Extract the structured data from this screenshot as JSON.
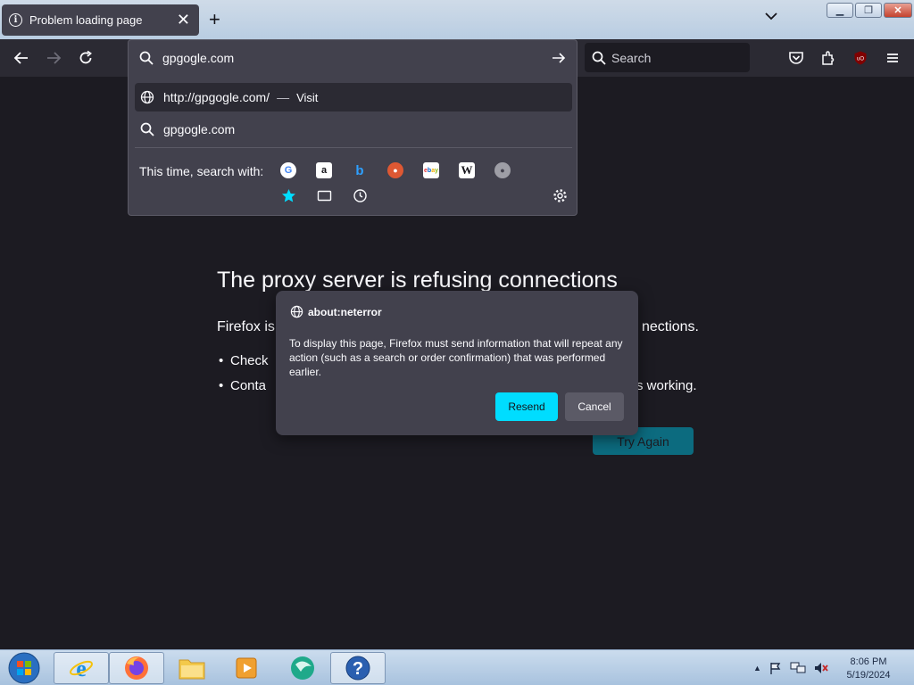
{
  "tab": {
    "title": "Problem loading page"
  },
  "toolbar": {
    "search_placeholder": "Search"
  },
  "urlbar": {
    "input_value": "gpgogle.com",
    "results": [
      {
        "url": "http://gpgogle.com/",
        "separator": "—",
        "action": "Visit"
      },
      {
        "query": "gpgogle.com"
      }
    ],
    "search_with_label": "This time, search with:",
    "engines": [
      "google",
      "amazon",
      "bing",
      "duckduckgo",
      "ebay",
      "wikipedia",
      "search"
    ]
  },
  "error_page": {
    "title": "The proxy server is refusing connections",
    "desc_start": "Firefox is",
    "desc_end": "nections.",
    "bullet1_start": "Check",
    "bullet2_start": "Conta",
    "bullet2_end": "s working.",
    "try_again": "Try Again"
  },
  "modal": {
    "title": "about:neterror",
    "body": "To display this page, Firefox must send information that will repeat any action (such as a search or order confirmation) that was performed earlier.",
    "resend": "Resend",
    "cancel": "Cancel"
  },
  "taskbar": {
    "time": "8:06 PM",
    "date": "5/19/2024"
  },
  "colors": {
    "accent": "#00ddff",
    "panel": "#42414d",
    "page_bg": "#1c1b22"
  }
}
